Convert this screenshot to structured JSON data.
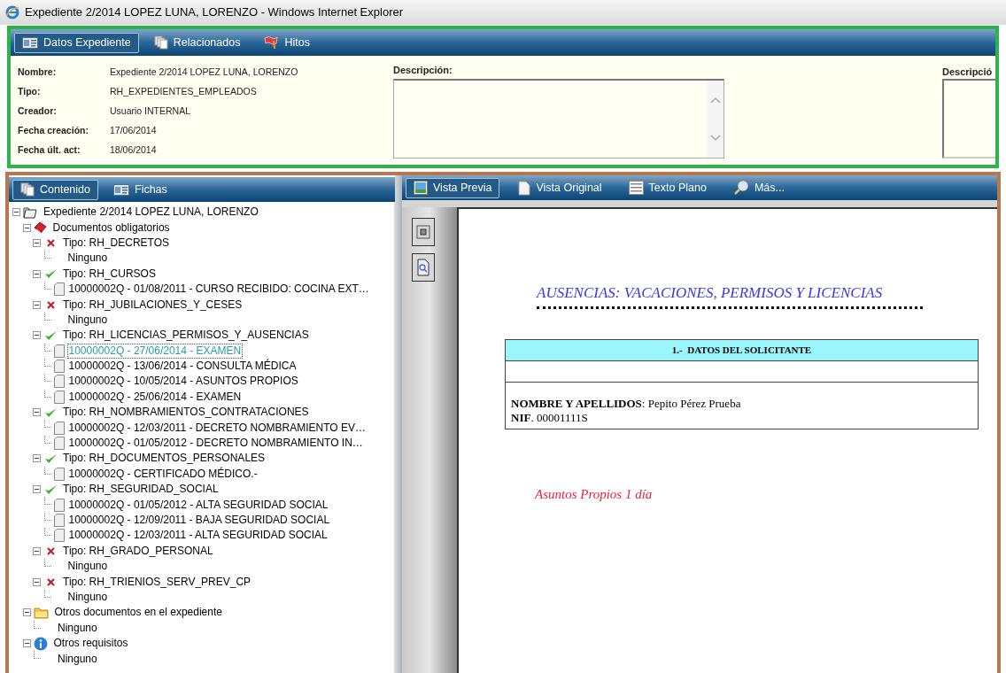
{
  "window": {
    "title": "Expediente 2/2014 LOPEZ LUNA, LORENZO - Windows Internet Explorer"
  },
  "header_tabs": [
    {
      "label": "Datos Expediente",
      "kind": "card",
      "selected": true
    },
    {
      "label": "Relacionados",
      "kind": "pages",
      "selected": false
    },
    {
      "label": "Hitos",
      "kind": "flag",
      "selected": false
    }
  ],
  "fields": [
    {
      "label": "Nombre:",
      "value": "Expediente 2/2014 LOPEZ LUNA, LORENZO"
    },
    {
      "label": "Tipo:",
      "value": "RH_EXPEDIENTES_EMPLEADOS"
    },
    {
      "label": "Creador:",
      "value": "Usuario INTERNAL"
    },
    {
      "label": "Fecha creación:",
      "value": "17/06/2014"
    },
    {
      "label": "Fecha últ. act:",
      "value": "18/06/2014"
    }
  ],
  "descriptions": [
    {
      "label": "Descripción:"
    },
    {
      "label": "Descripció"
    }
  ],
  "content_tabs": [
    {
      "label": "Contenido",
      "kind": "pages",
      "selected": true
    },
    {
      "label": "Fichas",
      "kind": "card",
      "selected": false
    }
  ],
  "tree": [
    {
      "kind": "case",
      "label": "Expediente 2/2014 LOPEZ LUNA, LORENZO",
      "expanded": true,
      "selected": false,
      "children": [
        {
          "kind": "required",
          "label": "Documentos obligatorios",
          "expanded": true,
          "selected": false,
          "children": [
            {
              "kind": "type",
              "label": "Tipo: RH_DECRETOS",
              "complete": false,
              "expanded": true,
              "selected": false,
              "children": [
                {
                  "kind": "none",
                  "label": "Ninguno",
                  "selected": false
                }
              ]
            },
            {
              "kind": "type",
              "label": "Tipo: RH_CURSOS",
              "complete": true,
              "expanded": true,
              "selected": false,
              "children": [
                {
                  "kind": "document",
                  "label": "10000002Q - 01/08/2011 - CURSO RECIBIDO: COCINA EXT…",
                  "selected": false
                }
              ]
            },
            {
              "kind": "type",
              "label": "Tipo: RH_JUBILACIONES_Y_CESES",
              "complete": false,
              "expanded": true,
              "selected": false,
              "children": [
                {
                  "kind": "none",
                  "label": "Ninguno",
                  "selected": false
                }
              ]
            },
            {
              "kind": "type",
              "label": "Tipo: RH_LICENCIAS_PERMISOS_Y_AUSENCIAS",
              "complete": true,
              "expanded": true,
              "selected": false,
              "children": [
                {
                  "kind": "document",
                  "label": "10000002Q - 27/06/2014 - EXAMEN",
                  "selected": true
                },
                {
                  "kind": "document",
                  "label": "10000002Q - 13/06/2014 - CONSULTA MÉDICA",
                  "selected": false
                },
                {
                  "kind": "document",
                  "label": "10000002Q - 10/05/2014 - ASUNTOS PROPIOS",
                  "selected": false
                },
                {
                  "kind": "document",
                  "label": "10000002Q - 25/06/2014 - EXAMEN",
                  "selected": false
                }
              ]
            },
            {
              "kind": "type",
              "label": "Tipo: RH_NOMBRAMIENTOS_CONTRATACIONES",
              "complete": true,
              "expanded": true,
              "selected": false,
              "children": [
                {
                  "kind": "document",
                  "label": "10000002Q - 12/03/2011 - DECRETO NOMBRAMIENTO EV…",
                  "selected": false
                },
                {
                  "kind": "document",
                  "label": "10000002Q - 01/05/2012 - DECRETO NOMBRAMIENTO IN…",
                  "selected": false
                }
              ]
            },
            {
              "kind": "type",
              "label": "Tipo: RH_DOCUMENTOS_PERSONALES",
              "complete": true,
              "expanded": true,
              "selected": false,
              "children": [
                {
                  "kind": "document",
                  "label": "10000002Q - CERTIFICADO MÉDICO.-",
                  "selected": false
                }
              ]
            },
            {
              "kind": "type",
              "label": "Tipo: RH_SEGURIDAD_SOCIAL",
              "complete": true,
              "expanded": true,
              "selected": false,
              "children": [
                {
                  "kind": "document",
                  "label": "10000002Q - 01/05/2012 - ALTA SEGURIDAD SOCIAL",
                  "selected": false
                },
                {
                  "kind": "document",
                  "label": "10000002Q - 12/09/2011 - BAJA SEGURIDAD SOCIAL",
                  "selected": false
                },
                {
                  "kind": "document",
                  "label": "10000002Q - 12/03/2011 - ALTA SEGURIDAD SOCIAL",
                  "selected": false
                }
              ]
            },
            {
              "kind": "type",
              "label": "Tipo: RH_GRADO_PERSONAL",
              "complete": false,
              "expanded": true,
              "selected": false,
              "children": [
                {
                  "kind": "none",
                  "label": "Ninguno",
                  "selected": false
                }
              ]
            },
            {
              "kind": "type",
              "label": "Tipo: RH_TRIENIOS_SERV_PREV_CP",
              "complete": false,
              "expanded": true,
              "selected": false,
              "children": [
                {
                  "kind": "none",
                  "label": "Ninguno",
                  "selected": false
                }
              ]
            }
          ]
        },
        {
          "kind": "other",
          "label": "Otros documentos en el expediente",
          "expanded": true,
          "selected": false,
          "children": [
            {
              "kind": "none",
              "label": "Ninguno",
              "selected": false
            }
          ]
        },
        {
          "kind": "requirements",
          "label": "Otros requisitos",
          "expanded": true,
          "selected": false,
          "children": [
            {
              "kind": "none",
              "label": "Ninguno",
              "selected": false
            }
          ]
        }
      ]
    }
  ],
  "view_tabs": [
    {
      "label": "Vista Previa",
      "kind": "image",
      "selected": true
    },
    {
      "label": "Vista Original",
      "kind": "page",
      "selected": false
    },
    {
      "label": "Texto Plano",
      "kind": "lines",
      "selected": false
    },
    {
      "label": "Más...",
      "kind": "magnifier",
      "selected": false
    }
  ],
  "document": {
    "title": "AUSENCIAS: VACACIONES, PERMISOS Y LICENCIAS",
    "section_heading": "1.-  DATOS DEL SOLICITANTE",
    "lines": [
      "**NOMBRE Y APELLIDOS**: Pepito Pérez Prueba",
      "**NIF**. 00001111S"
    ],
    "note": "Asuntos Propios 1 día"
  }
}
